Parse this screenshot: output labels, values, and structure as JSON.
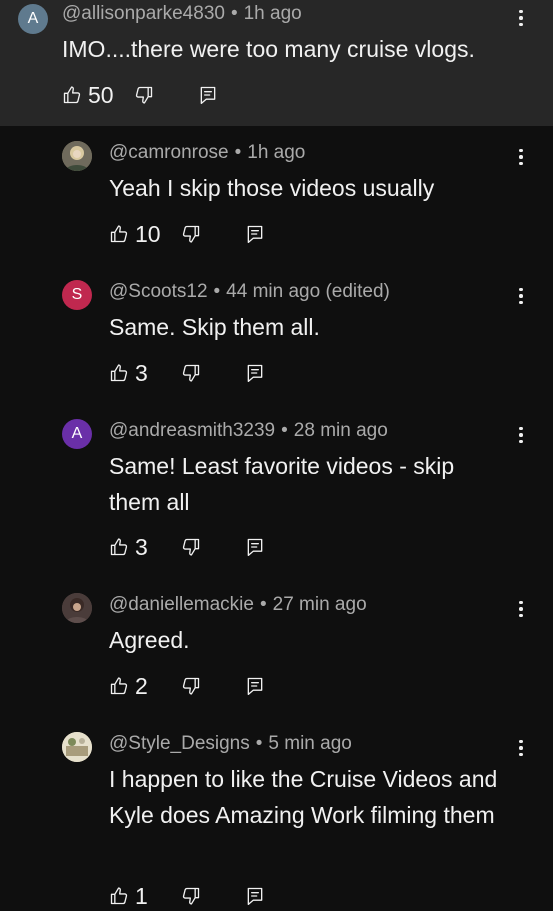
{
  "comments": [
    {
      "handle": "@allisonparke4830",
      "time": "1h ago",
      "text": "IMO....there were too many cruise vlogs.",
      "likes": "50",
      "avatar": {
        "letter": "A",
        "color": "#5f7a8e",
        "icon": "letter-avatar"
      }
    },
    {
      "handle": "@camronrose",
      "time": "1h ago",
      "text": "Yeah I skip those videos usually",
      "likes": "10",
      "avatar": {
        "letter": "",
        "color": "#8a7f62",
        "icon": "photo-avatar"
      }
    },
    {
      "handle": "@Scoots12",
      "time": "44 min ago (edited)",
      "text": "Same. Skip them all.",
      "likes": "3",
      "avatar": {
        "letter": "S",
        "color": "#c0284f",
        "icon": "letter-avatar"
      }
    },
    {
      "handle": "@andreasmith3239",
      "time": "28 min ago",
      "text": "Same! Least favorite videos - skip them all",
      "likes": "3",
      "avatar": {
        "letter": "A",
        "color": "#6a2fa8",
        "icon": "letter-avatar"
      }
    },
    {
      "handle": "@daniellemackie",
      "time": "27 min ago",
      "text": "Agreed.",
      "likes": "2",
      "avatar": {
        "letter": "",
        "color": "#5a4a48",
        "icon": "photo-avatar"
      }
    },
    {
      "handle": "@Style_Designs",
      "time": "5 min ago",
      "text": "I happen to like the Cruise Videos and Kyle does Amazing Work filming them",
      "likes": "1",
      "avatar": {
        "letter": "",
        "color": "#c9c2a8",
        "icon": "photo-avatar"
      }
    }
  ],
  "meta_separator": "•",
  "colors": {
    "background": "#0f0f0f",
    "highlight": "#272727",
    "secondary_text": "#aaaaaa",
    "primary_text": "#f1f1f1"
  },
  "icons": {
    "like": "thumbs-up-icon",
    "dislike": "thumbs-down-icon",
    "reply": "reply-icon",
    "more": "more-vert-icon"
  }
}
